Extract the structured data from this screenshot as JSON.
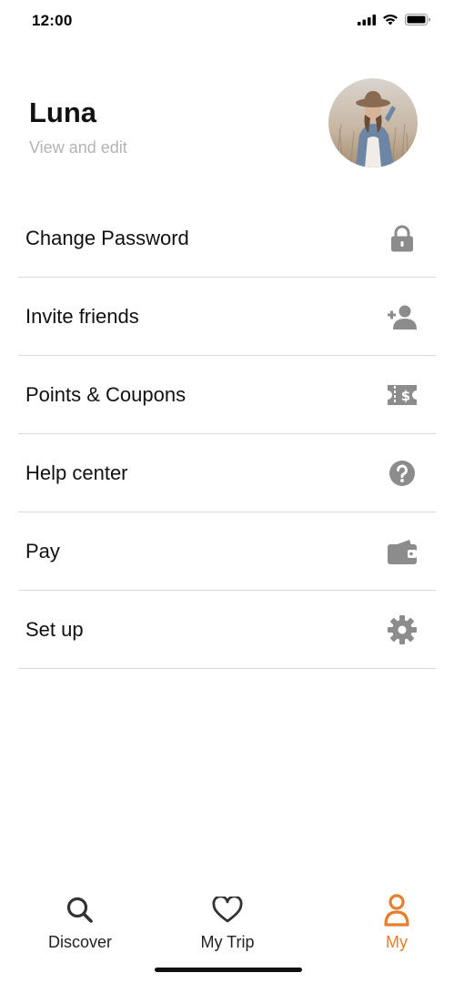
{
  "status_bar": {
    "time": "12:00",
    "signal_icon": "cellular-signal-icon",
    "wifi_icon": "wifi-icon",
    "battery_icon": "battery-icon"
  },
  "profile": {
    "name": "Luna",
    "subtitle": "View and edit",
    "avatar": "profile-photo"
  },
  "menu": {
    "items": [
      {
        "label": "Change Password",
        "icon": "lock-icon"
      },
      {
        "label": "Invite friends",
        "icon": "add-user-icon"
      },
      {
        "label": "Points & Coupons",
        "icon": "coupon-icon"
      },
      {
        "label": "Help center",
        "icon": "help-icon"
      },
      {
        "label": "Pay",
        "icon": "wallet-icon"
      },
      {
        "label": "Set up",
        "icon": "gear-icon"
      }
    ],
    "icon_color": "#8c8c8c"
  },
  "tabbar": {
    "tabs": [
      {
        "label": "Discover",
        "icon": "search-icon",
        "active": false
      },
      {
        "label": "My Trip",
        "icon": "heart-icon",
        "active": false
      },
      {
        "label": "My",
        "icon": "user-icon",
        "active": true
      }
    ],
    "accent_color": "#e87d2c"
  }
}
